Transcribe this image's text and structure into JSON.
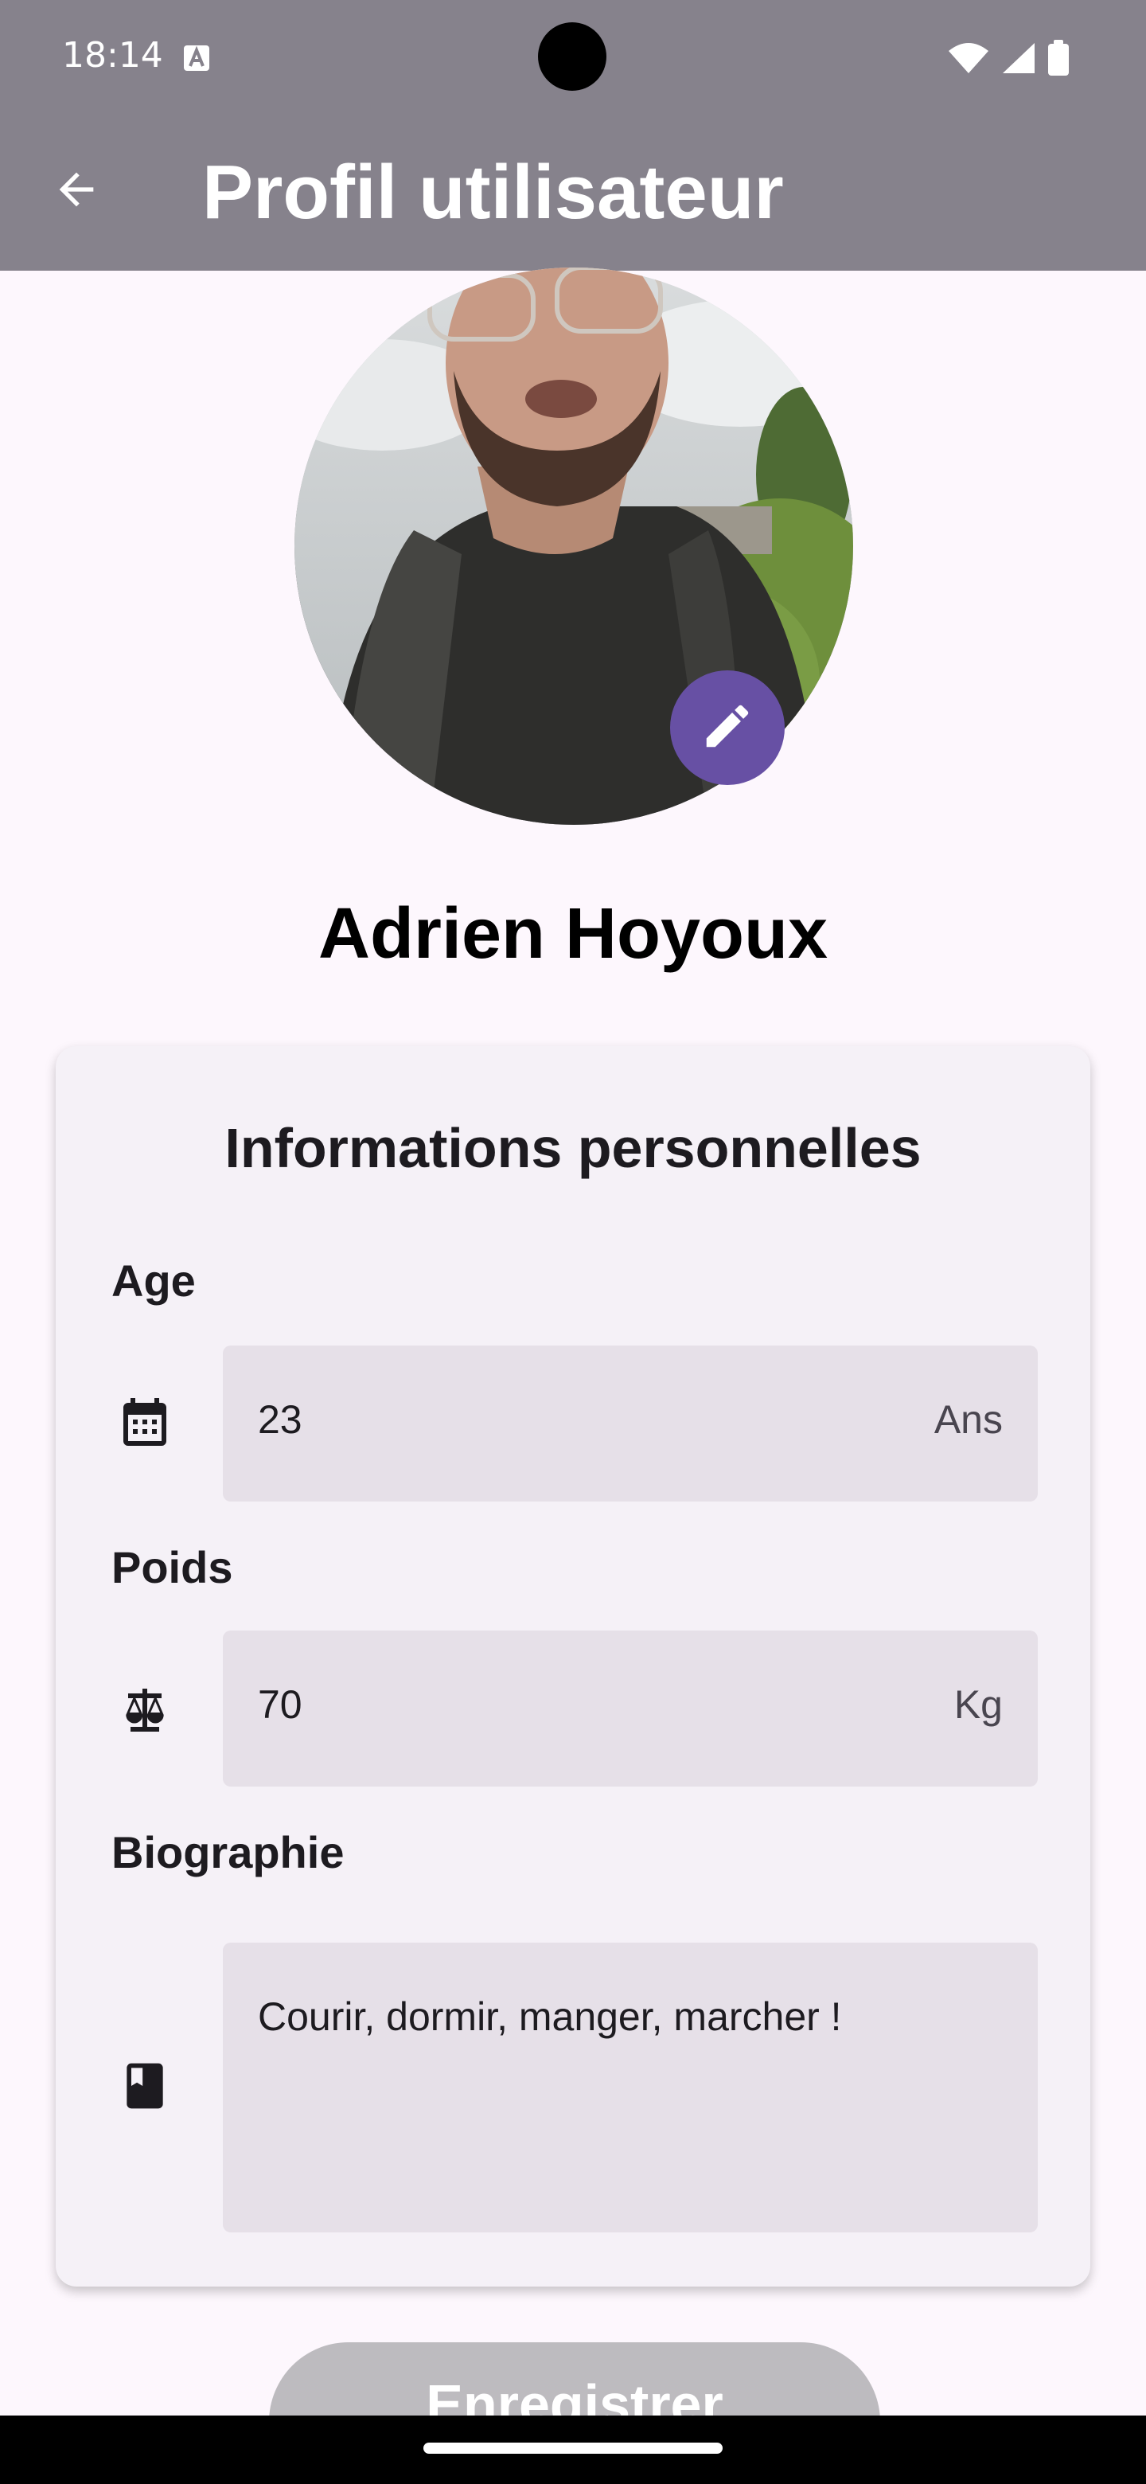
{
  "status_bar": {
    "time": "18:14",
    "notification_icon": "text-notification-icon",
    "icons": [
      "wifi-icon",
      "signal-icon",
      "battery-icon"
    ]
  },
  "app_bar": {
    "back_icon": "arrow-back-icon",
    "title": "Profil utilisateur"
  },
  "profile": {
    "name": "Adrien Hoyoux",
    "avatar": "profile-photo",
    "edit_icon": "pencil-icon"
  },
  "card": {
    "title": "Informations personnelles",
    "fields": [
      {
        "label": "Age",
        "icon": "calendar-icon",
        "value": "23",
        "suffix": "Ans"
      },
      {
        "label": "Poids",
        "icon": "scale-icon",
        "value": "70",
        "suffix": "Kg"
      },
      {
        "label": "Biographie",
        "icon": "book-icon",
        "value": "Courir, dormir, manger, marcher !"
      }
    ]
  },
  "actions": {
    "save_label": "Enregistrer"
  },
  "colors": {
    "app_bar": "#86828c",
    "accent": "#6750a4",
    "background": "#fdf7fd",
    "card": "#f5f1f7",
    "input": "#e6e0e8",
    "disabled_button": "#bdbbbf"
  }
}
